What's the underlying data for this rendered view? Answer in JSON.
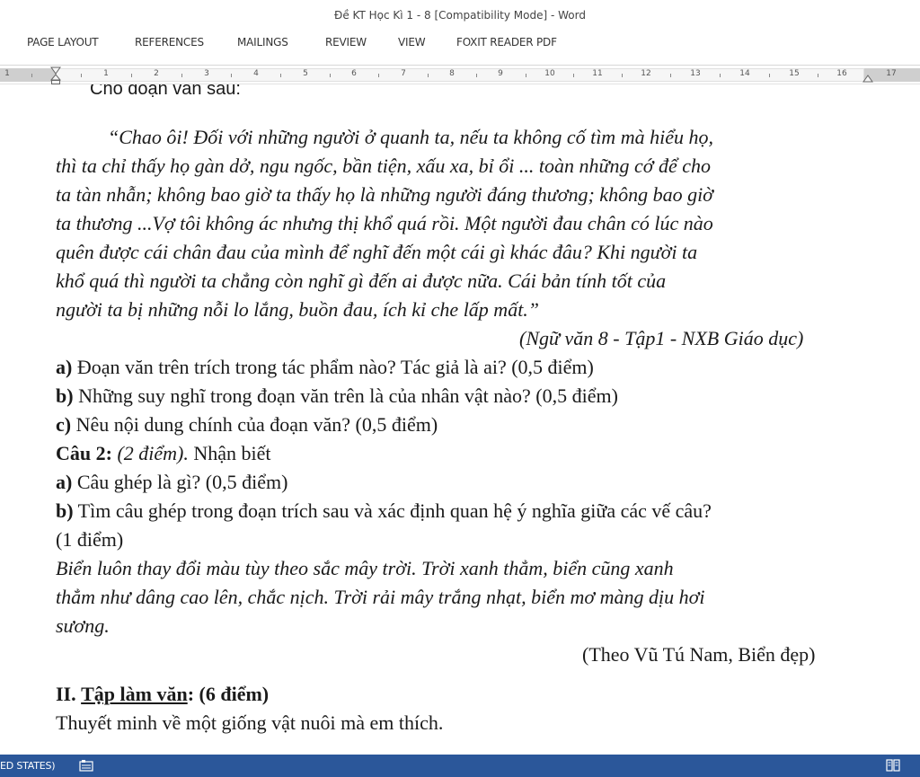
{
  "window": {
    "title": "Đề KT Học Kì 1 - 8 [Compatibility Mode] - Word"
  },
  "ribbon": {
    "tabs": [
      "PAGE LAYOUT",
      "REFERENCES",
      "MAILINGS",
      "REVIEW",
      "VIEW",
      "FOXIT READER PDF"
    ]
  },
  "ruler": {
    "numbers": [
      "1",
      "1",
      "2",
      "3",
      "4",
      "5",
      "6",
      "7",
      "8",
      "9",
      "10",
      "11",
      "12",
      "13",
      "14",
      "15",
      "16",
      "17"
    ]
  },
  "document": {
    "intro": "Cho đoạn văn sau:",
    "passage": [
      "“Chao ôi! Đối với những người ở quanh ta, nếu ta không cố tìm mà hiểu họ,",
      "thì ta chỉ thấy họ gàn dở, ngu ngốc, bần tiện, xấu xa, bỉ ổi ... toàn những cớ để cho",
      "ta tàn nhẫn; không bao giờ ta thấy họ là những người đáng thương; không bao giờ",
      "ta thương ...Vợ tôi không ác nhưng thị khổ quá rồi. Một người đau chân có lúc nào",
      "quên được cái chân đau của mình để nghĩ đến một cái gì khác đâu? Khi người ta",
      "khổ quá thì người ta chẳng còn nghĩ gì đến ai được nữa. Cái bản tính tốt của",
      "người ta bị những nỗi lo lắng, buồn đau, ích kỉ che lấp mất.”"
    ],
    "source1": "(Ngữ văn 8 - Tập1 - NXB Giáo dục)",
    "q1a_label": "a)",
    "q1a_text": " Đoạn văn trên trích trong tác phẩm nào? Tác giả là ai? (0,5 điểm)",
    "q1b_label": "b)",
    "q1b_text": " Những suy nghĩ trong đoạn văn trên là của nhân vật nào? (0,5 điểm)",
    "q1c_label": "c)",
    "q1c_text": " Nêu nội dung chính của đoạn văn? (0,5 điểm)",
    "q2_label": "Câu 2:",
    "q2_points": " (2 điểm).",
    "q2_text": " Nhận biết",
    "q2a_label": "a)",
    "q2a_text": " Câu ghép là gì? (0,5 điểm)",
    "q2b_label": "b)",
    "q2b_text": " Tìm câu ghép trong đoạn trích sau và xác định quan hệ ý nghĩa giữa các vế câu?",
    "q2b_points": "(1 điểm)",
    "passage2": [
      "Biển luôn thay đổi màu tùy theo sắc mây trời. Trời xanh thẳm, biển cũng xanh",
      "thẳm như dâng cao lên, chắc nịch. Trời rải mây trắng nhạt, biển mơ màng dịu hơi",
      "sương."
    ],
    "source2": "(Theo Vũ Tú Nam, Biển đẹp)",
    "section2_num": "II.",
    "section2_title": "Tập làm văn",
    "section2_points": ": (6 điểm)",
    "section2_task": "Thuyết minh về một giống vật nuôi mà em thích."
  },
  "statusbar": {
    "text": "ED STATES)"
  },
  "colors": {
    "statusbar_bg": "#2b579a",
    "ruler_gutter": "#cfcfcf"
  }
}
